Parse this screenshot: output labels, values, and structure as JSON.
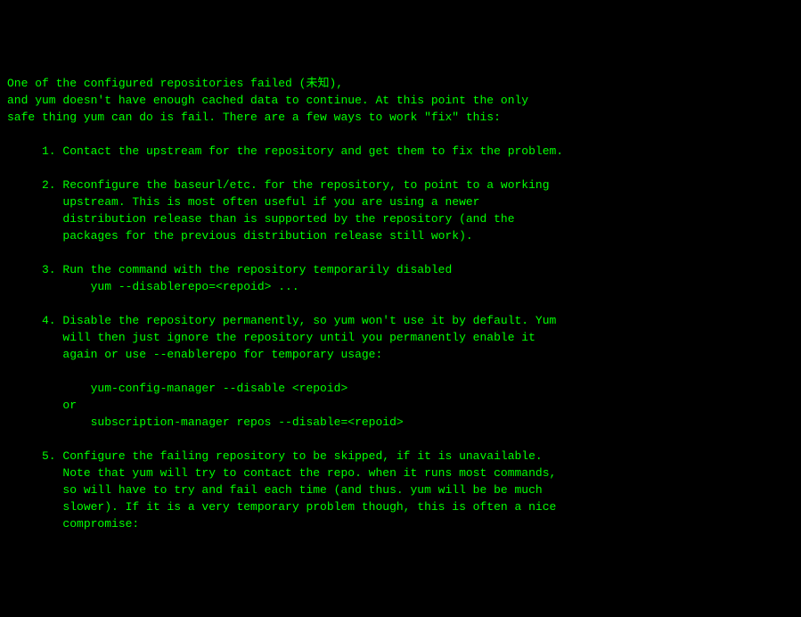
{
  "terminal": {
    "lines": [
      "One of the configured repositories failed (未知),",
      "and yum doesn't have enough cached data to continue. At this point the only",
      "safe thing yum can do is fail. There are a few ways to work \"fix\" this:",
      "",
      "     1. Contact the upstream for the repository and get them to fix the problem.",
      "",
      "     2. Reconfigure the baseurl/etc. for the repository, to point to a working",
      "        upstream. This is most often useful if you are using a newer",
      "        distribution release than is supported by the repository (and the",
      "        packages for the previous distribution release still work).",
      "",
      "     3. Run the command with the repository temporarily disabled",
      "            yum --disablerepo=<repoid> ...",
      "",
      "     4. Disable the repository permanently, so yum won't use it by default. Yum",
      "        will then just ignore the repository until you permanently enable it",
      "        again or use --enablerepo for temporary usage:",
      "",
      "            yum-config-manager --disable <repoid>",
      "        or",
      "            subscription-manager repos --disable=<repoid>",
      "",
      "     5. Configure the failing repository to be skipped, if it is unavailable.",
      "        Note that yum will try to contact the repo. when it runs most commands,",
      "        so will have to try and fail each time (and thus. yum will be be much",
      "        slower). If it is a very temporary problem though, this is often a nice",
      "        compromise:"
    ]
  }
}
